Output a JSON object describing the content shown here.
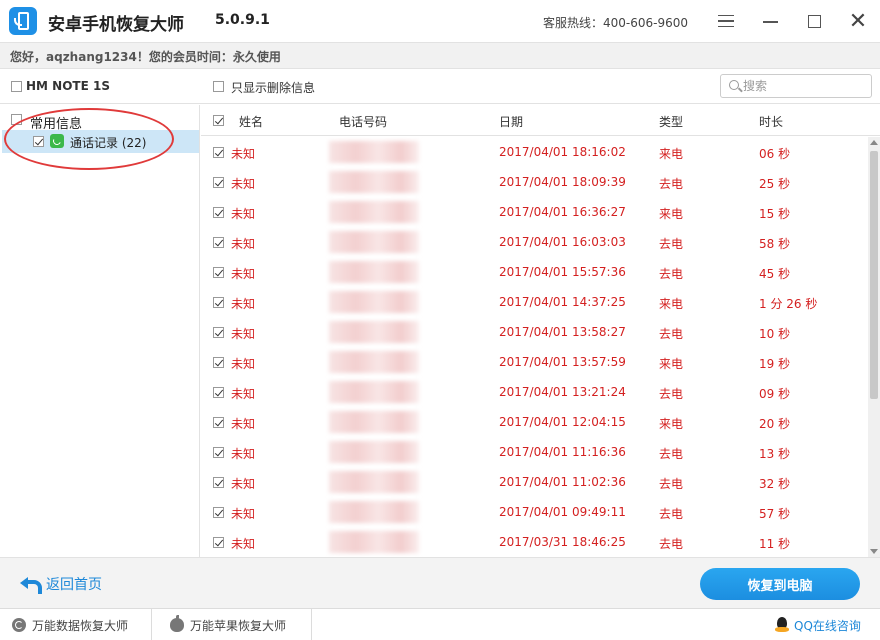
{
  "titlebar": {
    "app_name": "安卓手机恢复大师",
    "version": "5.0.9.1",
    "hotline": "客服热线：400-606-9600",
    "close_glyph": "✕"
  },
  "member": {
    "text": "您好，aqzhang1234！您的会员时间：永久使用"
  },
  "device": {
    "name": "HM NOTE 1S",
    "filter_label": "只显示删除信息",
    "search_placeholder": "搜索"
  },
  "tree": {
    "root_label": "常用信息",
    "child_label": "通话记录 (22)"
  },
  "table": {
    "headers": {
      "name": "姓名",
      "phone": "电话号码",
      "date": "日期",
      "type": "类型",
      "duration": "时长"
    },
    "rows": [
      {
        "name": "未知",
        "date": "2017/04/01 18:16:02",
        "type": "来电",
        "duration": "06 秒"
      },
      {
        "name": "未知",
        "date": "2017/04/01 18:09:39",
        "type": "去电",
        "duration": "25 秒"
      },
      {
        "name": "未知",
        "date": "2017/04/01 16:36:27",
        "type": "来电",
        "duration": "15 秒"
      },
      {
        "name": "未知",
        "date": "2017/04/01 16:03:03",
        "type": "去电",
        "duration": "58 秒"
      },
      {
        "name": "未知",
        "date": "2017/04/01 15:57:36",
        "type": "去电",
        "duration": "45 秒"
      },
      {
        "name": "未知",
        "date": "2017/04/01 14:37:25",
        "type": "来电",
        "duration": "1 分 26 秒"
      },
      {
        "name": "未知",
        "date": "2017/04/01 13:58:27",
        "type": "去电",
        "duration": "10 秒"
      },
      {
        "name": "未知",
        "date": "2017/04/01 13:57:59",
        "type": "来电",
        "duration": "19 秒"
      },
      {
        "name": "未知",
        "date": "2017/04/01 13:21:24",
        "type": "去电",
        "duration": "09 秒"
      },
      {
        "name": "未知",
        "date": "2017/04/01 12:04:15",
        "type": "来电",
        "duration": "20 秒"
      },
      {
        "name": "未知",
        "date": "2017/04/01 11:16:36",
        "type": "去电",
        "duration": "13 秒"
      },
      {
        "name": "未知",
        "date": "2017/04/01 11:02:36",
        "type": "去电",
        "duration": "32 秒"
      },
      {
        "name": "未知",
        "date": "2017/04/01 09:49:11",
        "type": "去电",
        "duration": "57 秒"
      },
      {
        "name": "未知",
        "date": "2017/03/31 18:46:25",
        "type": "去电",
        "duration": "11 秒"
      }
    ]
  },
  "actions": {
    "back_label": "返回首页",
    "recover_label": "恢复到电脑"
  },
  "footer": {
    "data_recovery": "万能数据恢复大师",
    "apple_recovery": "万能苹果恢复大师",
    "qq_consult": "QQ在线咨询"
  },
  "colors": {
    "accent": "#1e88d8",
    "row_text": "#d42020",
    "selection": "#cde6f7",
    "annotation_ring": "#e03a3a"
  }
}
